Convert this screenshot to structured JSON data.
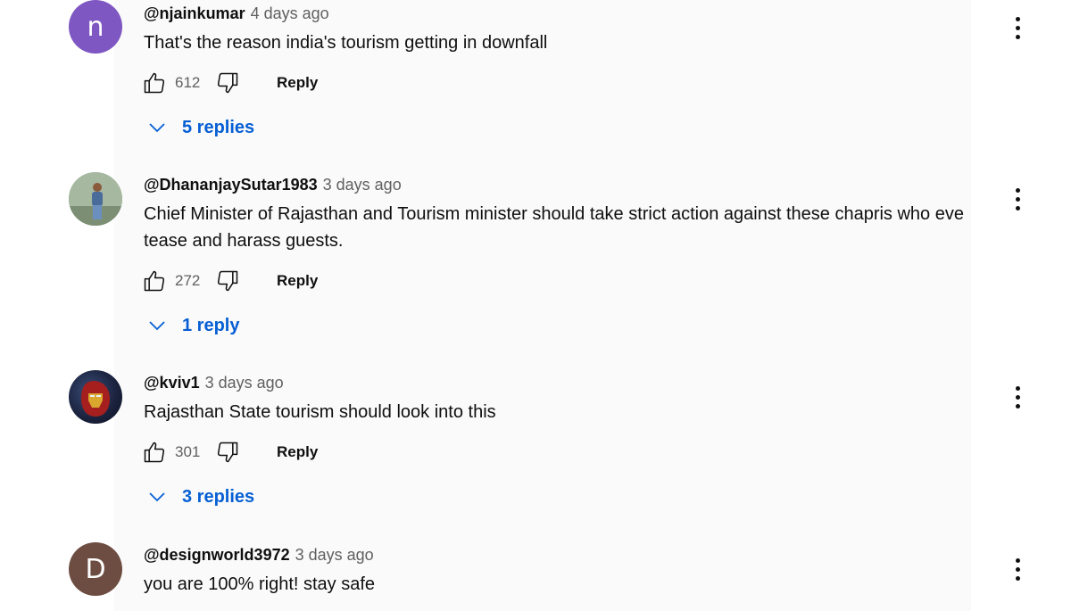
{
  "comments": [
    {
      "handle": "@njainkumar",
      "time": "4 days ago",
      "text": "That's the reason india's tourism getting in downfall",
      "avatar_letter": "n",
      "likes": "612",
      "reply_label": "Reply",
      "replies_label": "5 replies"
    },
    {
      "handle": "@DhananjaySutar1983",
      "time": "3 days ago",
      "text": "Chief Minister of Rajasthan and Tourism minister should take strict action against these chapris who eve tease and harass guests.",
      "avatar_letter": "",
      "likes": "272",
      "reply_label": "Reply",
      "replies_label": "1 reply"
    },
    {
      "handle": "@kviv1",
      "time": "3 days ago",
      "text": "Rajasthan State tourism should look into this",
      "avatar_letter": "",
      "likes": "301",
      "reply_label": "Reply",
      "replies_label": "3 replies"
    },
    {
      "handle": "@designworld3972",
      "time": "3 days ago",
      "text": "you are 100% right! stay safe",
      "avatar_letter": "D"
    }
  ],
  "colors": {
    "link_blue": "#065fd4",
    "avatar_n": "#7e57c2",
    "avatar_d": "#6d4c41",
    "secondary_text": "#606060"
  },
  "icons": [
    "thumbs-up-icon",
    "thumbs-down-icon",
    "chevron-down-icon",
    "more-vert-icon"
  ]
}
